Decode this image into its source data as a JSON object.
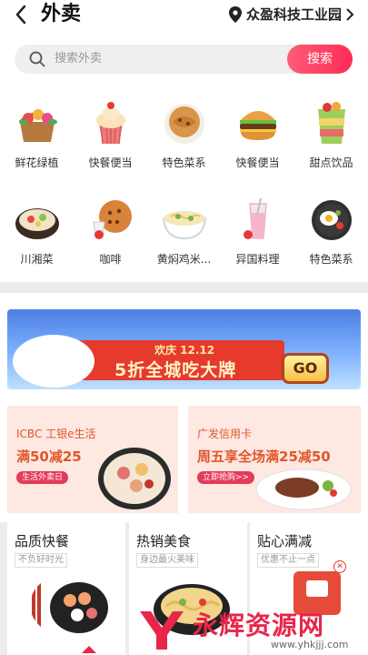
{
  "header": {
    "title": "外卖",
    "location": "众盈科技工业园"
  },
  "search": {
    "placeholder": "搜索外卖",
    "button": "搜索"
  },
  "categories": [
    {
      "label": "鲜花绿植",
      "icon": "flower-basket-icon"
    },
    {
      "label": "快餐便当",
      "icon": "cupcake-icon"
    },
    {
      "label": "特色菜系",
      "icon": "pancake-icon"
    },
    {
      "label": "快餐便当",
      "icon": "burger-icon"
    },
    {
      "label": "甜点饮品",
      "icon": "parfait-icon"
    },
    {
      "label": "川湘菜",
      "icon": "hotpot-icon"
    },
    {
      "label": "咖啡",
      "icon": "coffee-cookie-icon"
    },
    {
      "label": "黄焖鸡米...",
      "icon": "noodle-bowl-icon"
    },
    {
      "label": "异国料理",
      "icon": "smoothie-icon"
    },
    {
      "label": "特色菜系",
      "icon": "fried-egg-pan-icon"
    }
  ],
  "banner": {
    "event": "欢庆 12.12",
    "slogan": "5折全城吃大牌",
    "button": "GO"
  },
  "promos": [
    {
      "brand": "ICBC 工银e生活",
      "offer": "满50减25",
      "pill": "生活外卖日"
    },
    {
      "brand": "广发信用卡",
      "offer": "周五享全场满25减50",
      "pill": "立即抢购>>"
    }
  ],
  "bottom_cards": [
    {
      "title": "品质快餐",
      "subtitle": "不负好时光"
    },
    {
      "title": "热销美食",
      "subtitle": "身边最火美味"
    },
    {
      "title": "贴心满减",
      "subtitle": "优惠不止一点"
    }
  ],
  "watermark": {
    "text": "永辉资源网",
    "url": "www.yhkjjj.com"
  },
  "colors": {
    "accent": "#ff2d55",
    "promo_bg": "#fde8e2",
    "promo_text": "#e0562a"
  }
}
